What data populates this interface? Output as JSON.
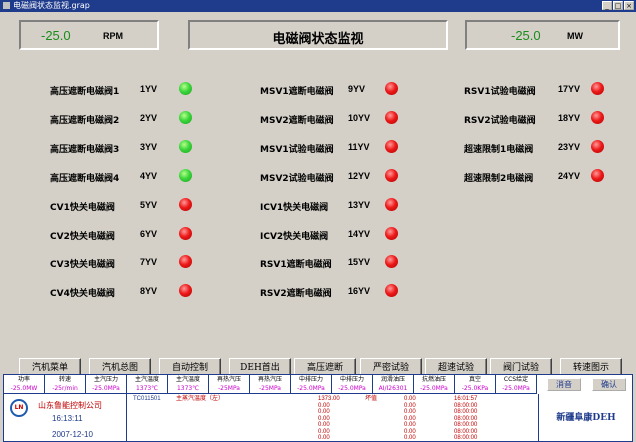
{
  "window_title": "电磁阀状态监视.grap",
  "header": {
    "left_value": "-25.0",
    "left_unit": "RPM",
    "title": "电磁阀状态监视",
    "right_value": "-25.0",
    "right_unit": "MW"
  },
  "columns": [
    [
      {
        "label": "高压遮断电磁阀1",
        "code": "1YV",
        "state": "green"
      },
      {
        "label": "高压遮断电磁阀2",
        "code": "2YV",
        "state": "green"
      },
      {
        "label": "高压遮断电磁阀3",
        "code": "3YV",
        "state": "green"
      },
      {
        "label": "高压遮断电磁阀4",
        "code": "4YV",
        "state": "green"
      },
      {
        "label": "CV1快关电磁阀",
        "code": "5YV",
        "state": "red"
      },
      {
        "label": "CV2快关电磁阀",
        "code": "6YV",
        "state": "red"
      },
      {
        "label": "CV3快关电磁阀",
        "code": "7YV",
        "state": "red"
      },
      {
        "label": "CV4快关电磁阀",
        "code": "8YV",
        "state": "red"
      }
    ],
    [
      {
        "label": "MSV1遮断电磁阀",
        "code": "9YV",
        "state": "red"
      },
      {
        "label": "MSV2遮断电磁阀",
        "code": "10YV",
        "state": "red"
      },
      {
        "label": "MSV1试验电磁阀",
        "code": "11YV",
        "state": "red"
      },
      {
        "label": "MSV2试验电磁阀",
        "code": "12YV",
        "state": "red"
      },
      {
        "label": "ICV1快关电磁阀",
        "code": "13YV",
        "state": "red"
      },
      {
        "label": "ICV2快关电磁阀",
        "code": "14YV",
        "state": "red"
      },
      {
        "label": "RSV1遮断电磁阀",
        "code": "15YV",
        "state": "red"
      },
      {
        "label": "RSV2遮断电磁阀",
        "code": "16YV",
        "state": "red"
      }
    ],
    [
      {
        "label": "RSV1试验电磁阀",
        "code": "17YV",
        "state": "red"
      },
      {
        "label": "RSV2试验电磁阀",
        "code": "18YV",
        "state": "red"
      },
      {
        "label": "超速限制1电磁阀",
        "code": "23YV",
        "state": "red"
      },
      {
        "label": "超速限制2电磁阀",
        "code": "24YV",
        "state": "red"
      }
    ]
  ],
  "nav_buttons": [
    "汽机菜单",
    "汽机总图",
    "自动控制",
    "DEH首出",
    "高压遮断",
    "严密试验",
    "超速试验",
    "阀门试验",
    "转速图示"
  ],
  "status_bar": {
    "params": [
      {
        "name": "功率",
        "value": "-25.0MW"
      },
      {
        "name": "转速",
        "value": "-25r/min"
      },
      {
        "name": "主汽压力",
        "value": "-25.0MPa"
      },
      {
        "name": "主汽温度",
        "value": "1373℃"
      },
      {
        "name": "主汽温度",
        "value": "1373℃"
      },
      {
        "name": "再热汽压",
        "value": "-25MPa"
      },
      {
        "name": "再热汽压",
        "value": "-25MPa"
      },
      {
        "name": "中排压力",
        "value": "-25.0MPa"
      },
      {
        "name": "中排压力",
        "value": "-25.0MPa"
      },
      {
        "name": "润滑油压",
        "value": "AI/I26301"
      },
      {
        "name": "抗燃油压",
        "value": "-25.0MPa"
      },
      {
        "name": "真空",
        "value": "-25.0KPa"
      },
      {
        "name": "CCS给定",
        "value": "-25.0MPa"
      }
    ],
    "clear_label": "消音",
    "confirm_label": "确认",
    "company": "山东鲁能控制公司",
    "logo_text": "LN",
    "time": "16:13:11",
    "date": "2007-12-10",
    "alarm": {
      "id": "TC011501",
      "desc": "主蒸汽温度（左）",
      "values": [
        "1373.00",
        "0.00",
        "0.00",
        "0.00",
        "0.00",
        "0.00",
        "0.00"
      ],
      "status": "坏值",
      "col2": [
        "0.00",
        "0.00",
        "0.00",
        "0.00",
        "0.00",
        "0.00",
        "0.00"
      ],
      "times": [
        "16:01:57",
        "08:00:00",
        "08:00:00",
        "08:00:00",
        "08:00:00",
        "08:00:00",
        "08:00:00"
      ]
    },
    "brand": "新疆阜康DEH"
  }
}
